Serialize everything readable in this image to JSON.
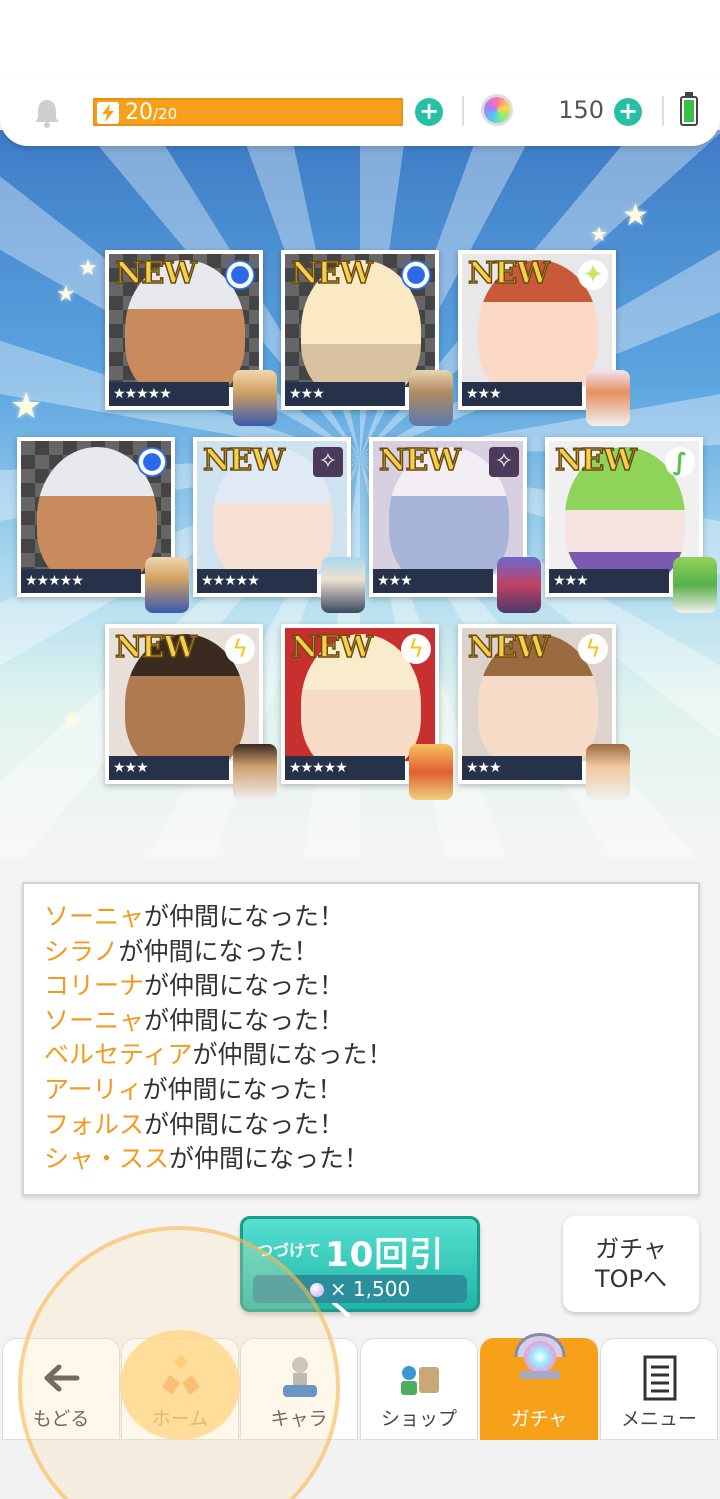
{
  "header": {
    "stamina_current": "20",
    "stamina_max": "/20",
    "gem_count": "150",
    "colors": {
      "stamina": "#f7a11a",
      "plus": "#26c0a6"
    }
  },
  "cards": [
    {
      "new": "NEW",
      "stars": "★★★★★",
      "attr": "water"
    },
    {
      "new": "NEW",
      "stars": "★★★",
      "attr": "water"
    },
    {
      "new": "NEW",
      "stars": "★★★",
      "attr": "light"
    },
    {
      "new": "",
      "stars": "★★★★★",
      "attr": "water"
    },
    {
      "new": "NEW",
      "stars": "★★★★★",
      "attr": "dark"
    },
    {
      "new": "NEW",
      "stars": "★★★",
      "attr": "dark"
    },
    {
      "new": "NEW",
      "stars": "★★★",
      "attr": "wind"
    },
    {
      "new": "NEW",
      "stars": "★★★",
      "attr": "thunder"
    },
    {
      "new": "NEW",
      "stars": "★★★★★",
      "attr": "thunder"
    },
    {
      "new": "NEW",
      "stars": "★★★",
      "attr": "thunder"
    }
  ],
  "messages": [
    {
      "name": "ソーニャ",
      "text": "が仲間になった！"
    },
    {
      "name": "シラノ",
      "text": "が仲間になった！"
    },
    {
      "name": "コリーナ",
      "text": "が仲間になった！"
    },
    {
      "name": "ソーニャ",
      "text": "が仲間になった！"
    },
    {
      "name": "ベルセティア",
      "text": "が仲間になった！"
    },
    {
      "name": "アーリィ",
      "text": "が仲間になった！"
    },
    {
      "name": "フォルス",
      "text": "が仲間になった！"
    },
    {
      "name": "シャ・スス",
      "text": "が仲間になった！"
    }
  ],
  "pull_button": {
    "small": "つづけて",
    "big": "10回引く",
    "cost": "× 1,500"
  },
  "gacha_top": {
    "line1": "ガチャ",
    "line2": "TOPへ"
  },
  "tabs": [
    {
      "label": "もどる",
      "icon": "back-arrow-icon"
    },
    {
      "label": "ホーム",
      "icon": "home-icon"
    },
    {
      "label": "キャラ",
      "icon": "character-icon"
    },
    {
      "label": "ショップ",
      "icon": "shop-icon"
    },
    {
      "label": "ガチャ",
      "icon": "gacha-icon"
    },
    {
      "label": "メニュー",
      "icon": "menu-list-icon"
    }
  ]
}
